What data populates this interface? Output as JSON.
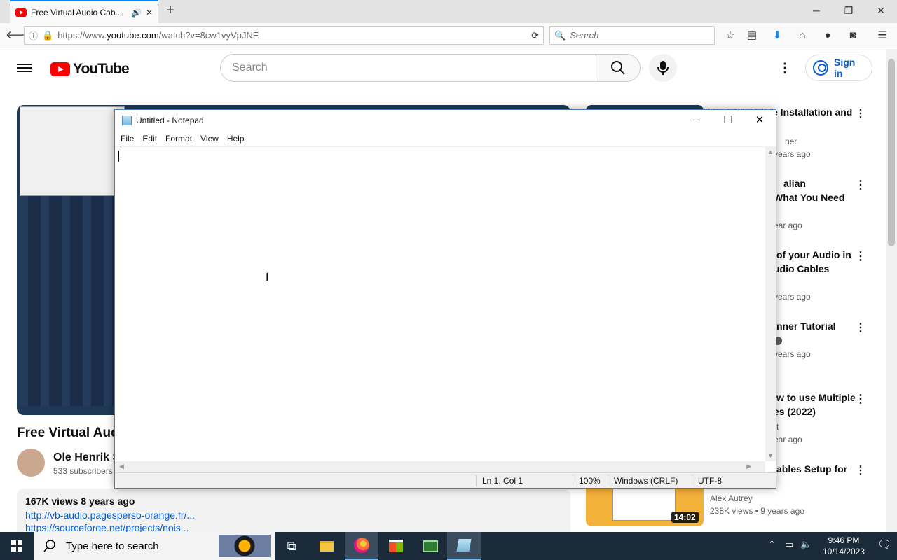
{
  "browser": {
    "tab_title": "Free Virtual Audio Cab...",
    "url_prefix": "https://www.",
    "url_domain": "youtube.com",
    "url_path": "/watch?v=8cw1vyVpJNE",
    "search_placeholder": "Search"
  },
  "youtube": {
    "logo_text": "YouTube",
    "search_placeholder": "Search",
    "sign_in": "Sign in",
    "video_title": "Free Virtual Audi",
    "channel_name": "Ole Henrik S",
    "channel_subs": "533 subscribers",
    "views_date": "167K views  8 years ago",
    "desc_link1": "http://vb-audio.pagesperso-orange.fr/...",
    "desc_link2": "https://sourceforge.net/projects/nois...",
    "related": [
      {
        "title": "VB-Audio Cable Installation and",
        "meta1": "ner",
        "meta2": "years ago"
      },
      {
        "title": "alian",
        "title2": "What You Need",
        "meta": "ear ago"
      },
      {
        "title": "of your Audio in",
        "title2": "udio Cables",
        "meta": "years ago"
      },
      {
        "title": "nner Tutorial",
        "meta": "years ago"
      },
      {
        "title": "w to use Multiple",
        "title2": "es (2022)",
        "meta1": "t",
        "meta2": "ear ago"
      },
      {
        "title": "ables Setup for",
        "channel": "Alex Autrey",
        "meta": "238K views  • 9 years ago",
        "duration": "14:02"
      }
    ]
  },
  "notepad": {
    "title": "Untitled - Notepad",
    "menu": [
      "File",
      "Edit",
      "Format",
      "View",
      "Help"
    ],
    "status": {
      "position": "Ln 1, Col 1",
      "zoom": "100%",
      "line_ending": "Windows (CRLF)",
      "encoding": "UTF-8"
    }
  },
  "taskbar": {
    "search_placeholder": "Type here to search",
    "time": "9:46 PM",
    "date": "10/14/2023"
  },
  "colors": {
    "youtube_red": "#ff0000",
    "link_blue": "#065fd4",
    "taskbar": "#1c2b3a"
  }
}
